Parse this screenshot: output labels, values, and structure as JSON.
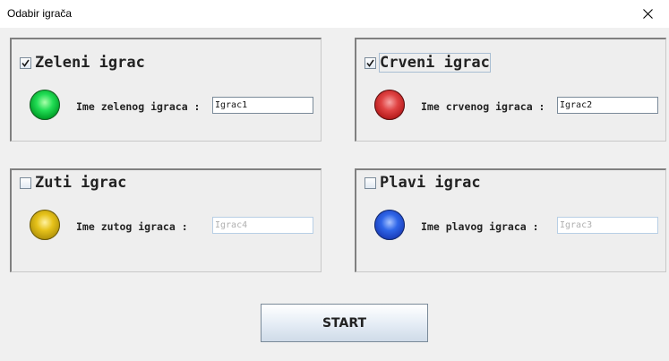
{
  "window": {
    "title": "Odabir igrača"
  },
  "panels": [
    {
      "checkbox_label": "Zeleni igrac",
      "checked": true,
      "name_label": "Ime zelenog igraca :",
      "input_value": "Igrac1",
      "enabled": true,
      "orb_color": "#00a028"
    },
    {
      "checkbox_label": "Crveni igrac",
      "checked": true,
      "name_label": "Ime crvenog igraca :",
      "input_value": "Igrac2",
      "enabled": true,
      "orb_color": "#c42222"
    },
    {
      "checkbox_label": "Zuti igrac",
      "checked": false,
      "name_label": "Ime zutog igraca :",
      "input_value": "Igrac4",
      "enabled": false,
      "orb_color": "#d4b214"
    },
    {
      "checkbox_label": "Plavi igrac",
      "checked": false,
      "name_label": "Ime plavog igraca :",
      "input_value": "Igrac3",
      "enabled": false,
      "orb_color": "#2454d8"
    }
  ],
  "start_button": {
    "label": "START"
  },
  "icons": {
    "close": "close-icon",
    "check": "check-icon"
  }
}
